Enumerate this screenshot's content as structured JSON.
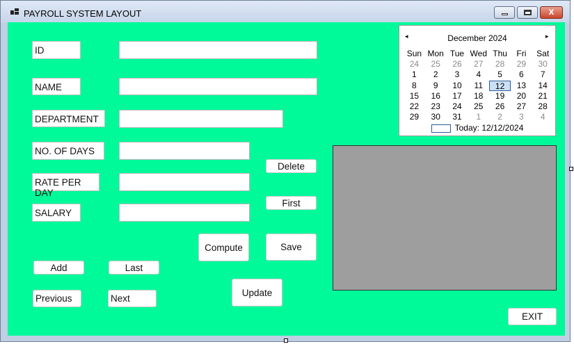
{
  "window": {
    "title": "PAYROLL SYSTEM LAYOUT"
  },
  "titlebar_buttons": {
    "minimize": "",
    "maximize": "",
    "close": "x"
  },
  "fields": {
    "id_label": "ID",
    "name_label": "NAME",
    "department_label": "DEPARTMENT",
    "days_label": "NO. OF DAYS",
    "rate_label": "RATE PER DAY",
    "salary_label": "SALARY",
    "id_value": "",
    "name_value": "",
    "department_value": "",
    "days_value": "",
    "rate_value": "",
    "salary_value": ""
  },
  "buttons": {
    "delete": "Delete",
    "first": "First",
    "compute": "Compute",
    "save": "Save",
    "add": "Add",
    "last": "Last",
    "previous": "Previous",
    "next": "Next",
    "update": "Update",
    "exit": "EXIT"
  },
  "calendar": {
    "month_label": "December 2024",
    "prev_arrow": "◂",
    "next_arrow": "▸",
    "weekdays": [
      "Sun",
      "Mon",
      "Tue",
      "Wed",
      "Thu",
      "Fri",
      "Sat"
    ],
    "weeks": [
      [
        "24",
        "25",
        "26",
        "27",
        "28",
        "29",
        "30"
      ],
      [
        "1",
        "2",
        "3",
        "4",
        "5",
        "6",
        "7"
      ],
      [
        "8",
        "9",
        "10",
        "11",
        "12",
        "13",
        "14"
      ],
      [
        "15",
        "16",
        "17",
        "18",
        "19",
        "20",
        "21"
      ],
      [
        "22",
        "23",
        "24",
        "25",
        "26",
        "27",
        "28"
      ],
      [
        "29",
        "30",
        "31",
        "1",
        "2",
        "3",
        "4"
      ]
    ],
    "selected_day": "12",
    "today_text": "Today: 12/12/2024"
  }
}
